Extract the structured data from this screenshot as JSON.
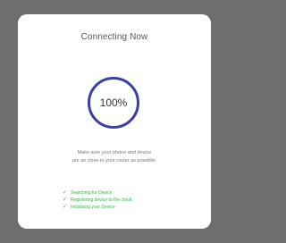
{
  "dialog": {
    "title": "Connecting Now",
    "progress": {
      "label": "100%",
      "value": 1.0,
      "ring_color": "#3a3fa8"
    },
    "info_lines": [
      "Make sure your phone and device",
      "are as close to your router as possible."
    ],
    "steps": [
      {
        "label": "Searching for Device",
        "icon": "checkmark-icon",
        "status": "done"
      },
      {
        "label": "Registering device to the cloud",
        "icon": "checkmark-icon",
        "status": "done"
      },
      {
        "label": "Initializing your Device",
        "icon": "checkmark-icon",
        "status": "done"
      }
    ],
    "step_color": "#37b24d"
  }
}
